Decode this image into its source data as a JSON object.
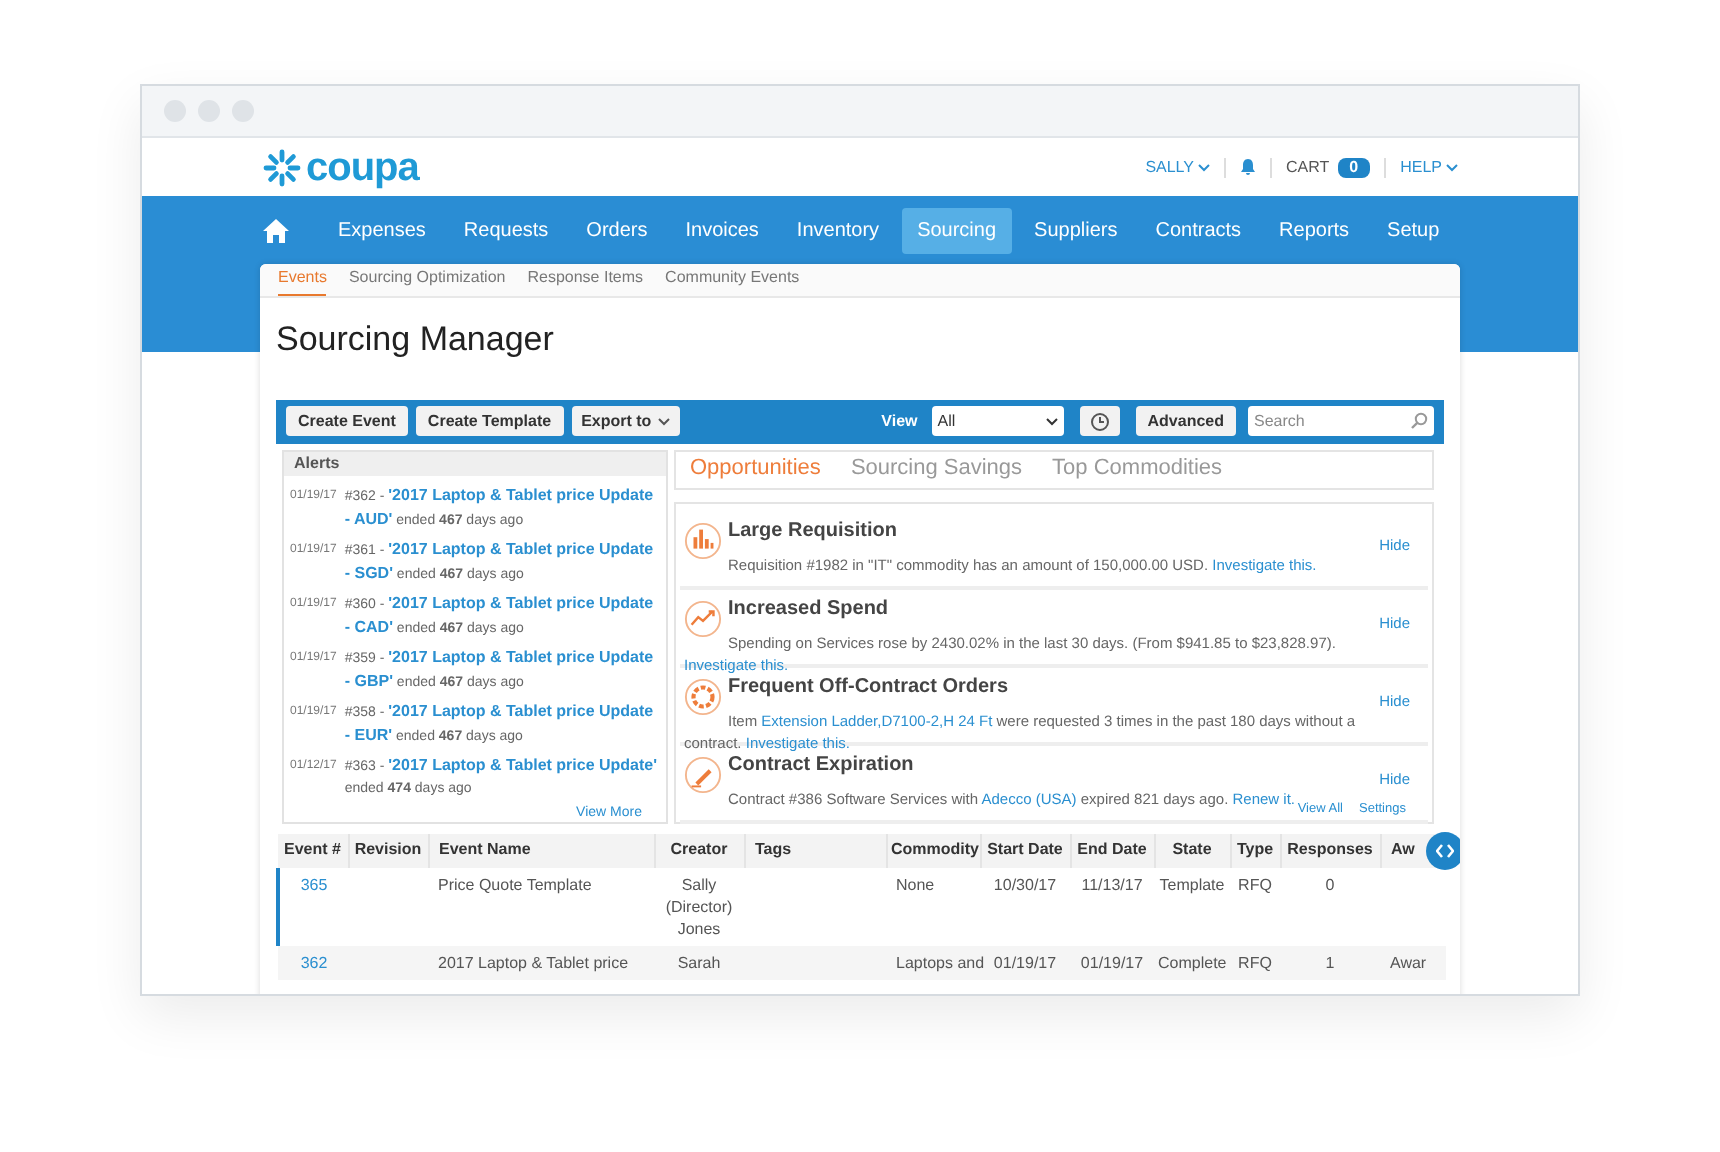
{
  "header": {
    "logo": "coupa",
    "user": "SALLY",
    "cart_label": "CART",
    "cart_count": "0",
    "help": "HELP"
  },
  "nav": [
    {
      "label": "Expenses",
      "selected": false
    },
    {
      "label": "Requests",
      "selected": false
    },
    {
      "label": "Orders",
      "selected": false
    },
    {
      "label": "Invoices",
      "selected": false
    },
    {
      "label": "Inventory",
      "selected": false
    },
    {
      "label": "Sourcing",
      "selected": true
    },
    {
      "label": "Suppliers",
      "selected": false
    },
    {
      "label": "Contracts",
      "selected": false
    },
    {
      "label": "Reports",
      "selected": false
    },
    {
      "label": "Setup",
      "selected": false
    }
  ],
  "subnav": [
    {
      "label": "Events",
      "selected": true
    },
    {
      "label": "Sourcing Optimization",
      "selected": false
    },
    {
      "label": "Response Items",
      "selected": false
    },
    {
      "label": "Community Events",
      "selected": false
    }
  ],
  "page_title": "Sourcing Manager",
  "toolbar": {
    "buttons": [
      "Create Event",
      "Create Template"
    ],
    "export": "Export to",
    "view_label": "View",
    "view_value": "All",
    "advanced": "Advanced",
    "search_placeholder": "Search"
  },
  "alerts": {
    "title": "Alerts",
    "items": [
      {
        "date": "01/19/17",
        "number": "#362 -",
        "link_lines": [
          "'2017 Laptop & Tablet price Update",
          "- AUD'"
        ],
        "suffix": "ended **467** days ago"
      },
      {
        "date": "01/19/17",
        "number": "#361 -",
        "link_lines": [
          "'2017 Laptop & Tablet price Update",
          "- SGD'"
        ],
        "suffix": "ended **467** days ago"
      },
      {
        "date": "01/19/17",
        "number": "#360 -",
        "link_lines": [
          "'2017 Laptop & Tablet price Update",
          "- CAD'"
        ],
        "suffix": "ended **467** days ago"
      },
      {
        "date": "01/19/17",
        "number": "#359 -",
        "link_lines": [
          "'2017 Laptop & Tablet price Update",
          "- GBP'"
        ],
        "suffix": "ended **467** days ago"
      },
      {
        "date": "01/19/17",
        "number": "#358 -",
        "link_lines": [
          "'2017 Laptop & Tablet price Update",
          "- EUR'"
        ],
        "suffix": "ended **467** days ago"
      },
      {
        "date": "01/12/17",
        "number": "#363 -",
        "link_lines": [
          "'2017 Laptop & Tablet price Update'"
        ],
        "suffix": "ended **474** days ago"
      }
    ],
    "view_more": "View More"
  },
  "tabs": [
    {
      "label": "Opportunities",
      "selected": true
    },
    {
      "label": "Sourcing Savings",
      "selected": false
    },
    {
      "label": "Top Commodities",
      "selected": false
    }
  ],
  "opportunities": [
    {
      "kind": "bars",
      "title": "Large Requisition",
      "segments": [
        {
          "text": "Requisition #1982 in \"IT\" commodity has an amount of 150,000.00 USD. ",
          "link": false
        },
        {
          "text": "Investigate this.",
          "link": true
        }
      ],
      "action": "Hide"
    },
    {
      "kind": "trend",
      "title": "Increased Spend",
      "segments": [
        {
          "text": "Spending on Services rose by 2430.02% in the last 30 days. (From $941.85 to $23,828.97). ",
          "link": false
        },
        {
          "text": "Investigate this.",
          "link": true
        }
      ],
      "action": "Hide"
    },
    {
      "kind": "ring",
      "title": "Frequent Off-Contract Orders",
      "segments": [
        {
          "text": "Item ",
          "link": false
        },
        {
          "text": "Extension Ladder,D7100-2,H 24 Ft",
          "link": true
        },
        {
          "text": " were requested 3 times in the past 180 days without a contract. ",
          "link": false
        },
        {
          "text": "Investigate this.",
          "link": true
        }
      ],
      "action": "Hide"
    },
    {
      "kind": "pen",
      "title": "Contract Expiration",
      "segments": [
        {
          "text": "Contract #386 Software Services with ",
          "link": false
        },
        {
          "text": "Adecco (USA)",
          "link": true
        },
        {
          "text": " expired 821 days ago. ",
          "link": false
        },
        {
          "text": "Renew it.",
          "link": true
        }
      ],
      "action": "Hide"
    }
  ],
  "opp_footer": [
    "View All",
    "Settings"
  ],
  "table": {
    "columns": [
      "Event #",
      "Revision",
      "Event Name",
      "Creator",
      "Tags",
      "Commodity",
      "Start Date",
      "End Date",
      "State",
      "Type",
      "Responses",
      "Aw"
    ],
    "rows": [
      {
        "selected": true,
        "cells": [
          "365",
          "",
          "Price Quote Template",
          "Sally (Director) Jones",
          "",
          "None",
          "10/30/17",
          "11/13/17",
          "Template",
          "RFQ",
          "0",
          ""
        ]
      },
      {
        "selected": false,
        "cells": [
          "362",
          "",
          "2017 Laptop & Tablet price",
          "Sarah",
          "",
          "Laptops and",
          "01/19/17",
          "01/19/17",
          "Complete",
          "RFQ",
          "1",
          "Awar"
        ]
      }
    ]
  }
}
